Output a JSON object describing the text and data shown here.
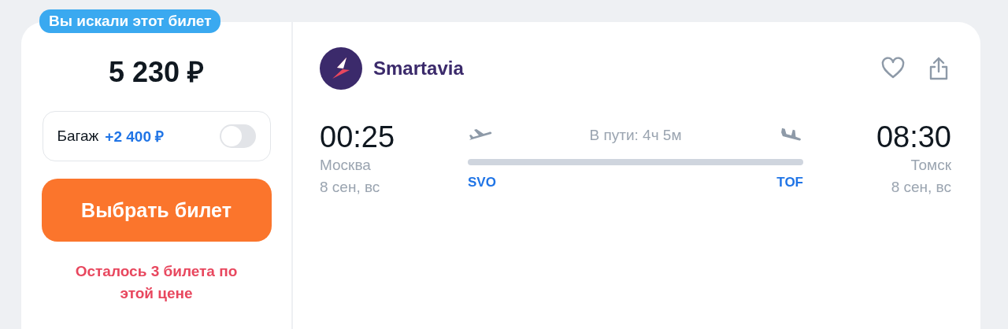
{
  "badge": "Вы искали этот билет",
  "price": "5 230 ₽",
  "baggage": {
    "label": "Багаж",
    "price": "+2 400 ₽",
    "on": false
  },
  "select_button": "Выбрать билет",
  "seats_left": "Осталось 3 билета по этой цене",
  "airline": {
    "name": "Smartavia"
  },
  "favorite": {
    "selected": false
  },
  "departure": {
    "time": "00:25",
    "city": "Москва",
    "date": "8 сен, вс",
    "code": "SVO"
  },
  "duration": "В пути: 4ч 5м",
  "arrival": {
    "time": "08:30",
    "city": "Томск",
    "date": "8 сен, вс",
    "code": "TOF"
  }
}
